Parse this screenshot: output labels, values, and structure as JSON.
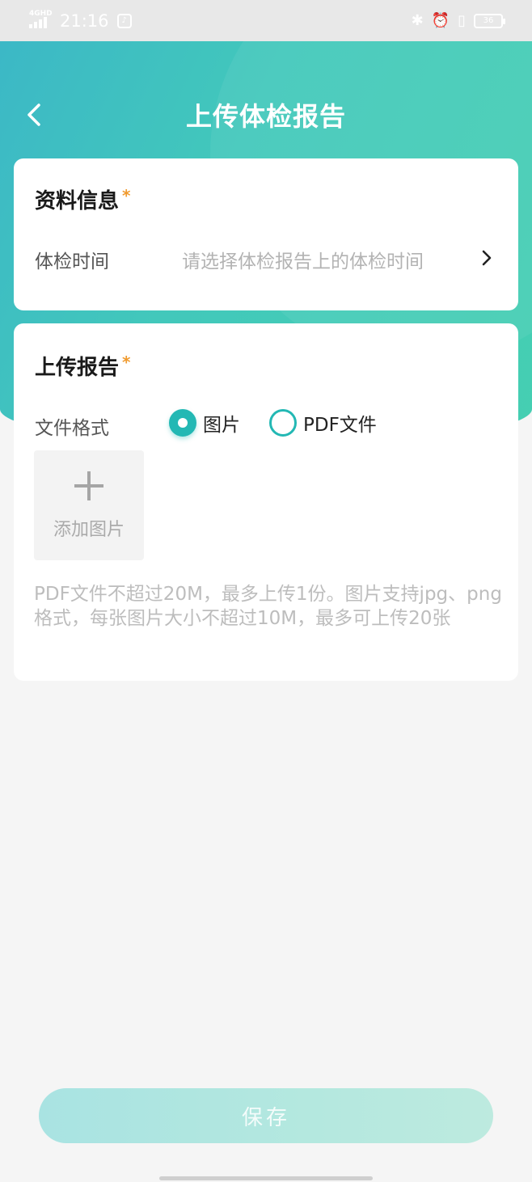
{
  "status_bar": {
    "network": "4GHD",
    "time": "21:16",
    "battery_level": "36"
  },
  "header": {
    "title": "上传体检报告"
  },
  "info_card": {
    "title": "资料信息",
    "required_mark": "*",
    "exam_time_label": "体检时间",
    "exam_time_placeholder": "请选择体检报告上的体检时间"
  },
  "upload_card": {
    "title": "上传报告",
    "required_mark": "*",
    "file_format_label": "文件格式",
    "format_options": [
      {
        "label": "图片",
        "selected": true
      },
      {
        "label": "PDF文件",
        "selected": false
      }
    ],
    "add_image_label": "添加图片",
    "hint": "PDF文件不超过20M，最多上传1份。图片支持jpg、png格式，每张图片大小不超过10M，最多可上传20张"
  },
  "save_button": {
    "label": "保存"
  },
  "colors": {
    "accent": "#23b8b4",
    "required": "#f09a2e",
    "header_gradient_start": "#3cb8c6",
    "header_gradient_end": "#45cfb2"
  }
}
